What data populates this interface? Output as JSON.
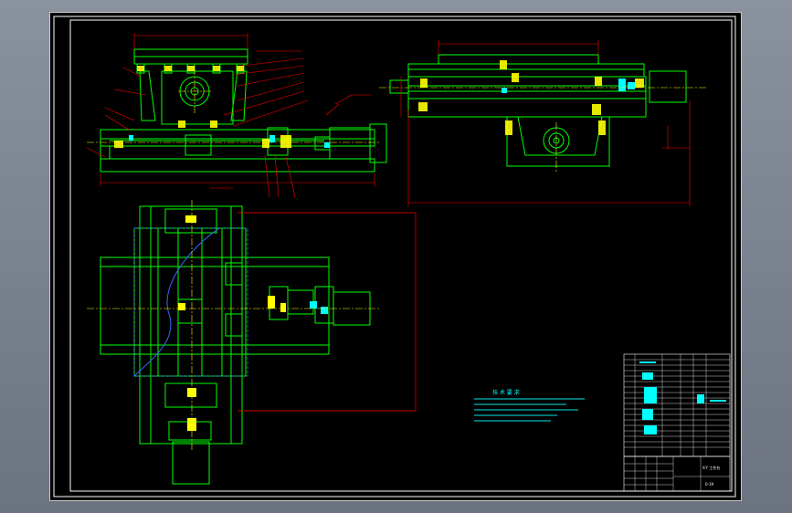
{
  "drawing": {
    "background": "#000000",
    "colors": {
      "frame": "#ffffff",
      "outline": "#00ff00",
      "dimension": "#ff0000",
      "centerline": "#ffff00",
      "highlight": "#00ffff",
      "hidden": "#3a6bff",
      "part": "#ffff00"
    },
    "notes_heading": "技 术 要 求",
    "title_block_label": "X-Y 工作台",
    "sheet_ref": "0-19"
  }
}
